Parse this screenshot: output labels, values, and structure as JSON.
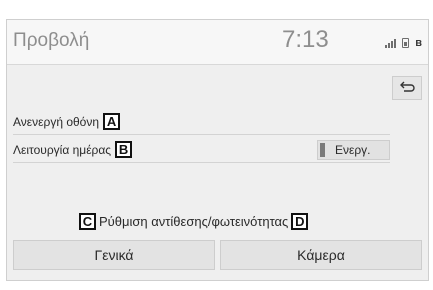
{
  "header": {
    "title": "Προβολή",
    "clock": "7:13",
    "icons": [
      "signal-icon",
      "phone-icon",
      "bluetooth-icon"
    ]
  },
  "back_button": {
    "icon": "back-arrow-icon"
  },
  "settings": {
    "rows": [
      {
        "label": "Ανενεργή οθόνη",
        "callout": "A"
      },
      {
        "label": "Λειτουργία ημέρας",
        "callout": "B",
        "toggle_label": "Ενεργ."
      }
    ]
  },
  "brightness": {
    "callout_left": "C",
    "label": "Ρύθμιση αντίθεσης/φωτεινότητας",
    "callout_right": "D"
  },
  "tabs": {
    "general": "Γενικά",
    "camera": "Κάμερα"
  }
}
